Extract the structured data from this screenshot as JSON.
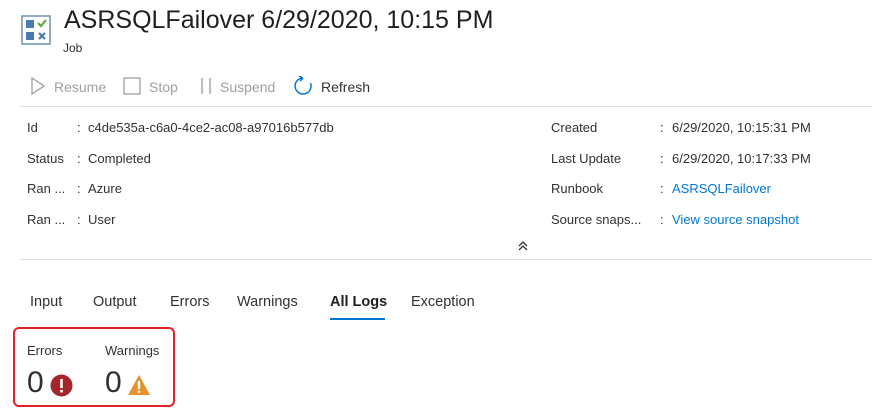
{
  "header": {
    "title": "ASRSQLFailover 6/29/2020, 10:15 PM",
    "subtitle": "Job",
    "icon": "job-icon"
  },
  "toolbar": {
    "resume_label": "Resume",
    "stop_label": "Stop",
    "suspend_label": "Suspend",
    "refresh_label": "Refresh"
  },
  "details": {
    "left": [
      {
        "label": "Id",
        "value": "c4de535a-c6a0-4ce2-ac08-a97016b577db"
      },
      {
        "label": "Status",
        "value": "Completed"
      },
      {
        "label": "Ran ...",
        "value": "Azure"
      },
      {
        "label": "Ran ...",
        "value": "User"
      }
    ],
    "right": [
      {
        "label": "Created",
        "value": "6/29/2020, 10:15:31 PM"
      },
      {
        "label": "Last Update",
        "value": "6/29/2020, 10:17:33 PM"
      },
      {
        "label": "Runbook",
        "value": "ASRSQLFailover"
      },
      {
        "label": "Source snaps...",
        "value": "View source snapshot"
      }
    ],
    "separator": ":"
  },
  "tabs": [
    {
      "label": "Input"
    },
    {
      "label": "Output"
    },
    {
      "label": "Errors"
    },
    {
      "label": "Warnings"
    },
    {
      "label": "All Logs"
    },
    {
      "label": "Exception"
    }
  ],
  "active_tab": "All Logs",
  "summary": {
    "errors_label": "Errors",
    "errors_count": "0",
    "warnings_label": "Warnings",
    "warnings_count": "0"
  },
  "colors": {
    "accent": "#0078d4",
    "error": "#a4262c",
    "warning": "#e8912d",
    "highlight": "#e0242a"
  }
}
